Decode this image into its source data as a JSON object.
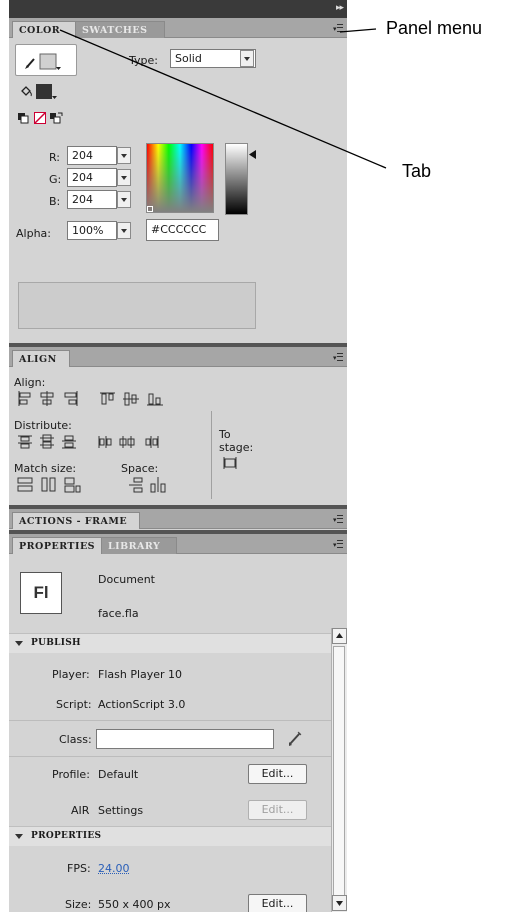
{
  "color_panel": {
    "tabs": [
      "COLOR",
      "SWATCHES"
    ],
    "type_label": "Type:",
    "type_value": "Solid",
    "r_label": "R:",
    "r_value": "204",
    "g_label": "G:",
    "g_value": "204",
    "b_label": "B:",
    "b_value": "204",
    "alpha_label": "Alpha:",
    "alpha_value": "100%",
    "hex_value": "#CCCCCC",
    "stroke_color": "#d0d0d0",
    "fill_color": "#333333"
  },
  "align_panel": {
    "tab": "ALIGN",
    "align_label": "Align:",
    "distribute_label": "Distribute:",
    "match_size_label": "Match size:",
    "space_label": "Space:",
    "to_stage_label_1": "To",
    "to_stage_label_2": "stage:"
  },
  "actions_panel": {
    "tab": "ACTIONS - FRAME"
  },
  "properties_panel": {
    "tabs": [
      "PROPERTIES",
      "LIBRARY"
    ],
    "doc_icon": "Fl",
    "doc_type": "Document",
    "doc_name": "face.fla",
    "publish_section": "PUBLISH",
    "player_label": "Player:",
    "player_value": "Flash Player 10",
    "script_label": "Script:",
    "script_value": "ActionScript 3.0",
    "class_label": "Class:",
    "class_value": "",
    "profile_label": "Profile:",
    "profile_value": "Default",
    "edit_label": "Edit...",
    "air_label": "AIR",
    "air_value": "Settings",
    "properties_section": "PROPERTIES",
    "fps_label": "FPS:",
    "fps_value": "24.00",
    "size_label": "Size:",
    "size_value": "550 x 400 px"
  },
  "annotations": {
    "panel_menu": "Panel menu",
    "tab": "Tab"
  }
}
